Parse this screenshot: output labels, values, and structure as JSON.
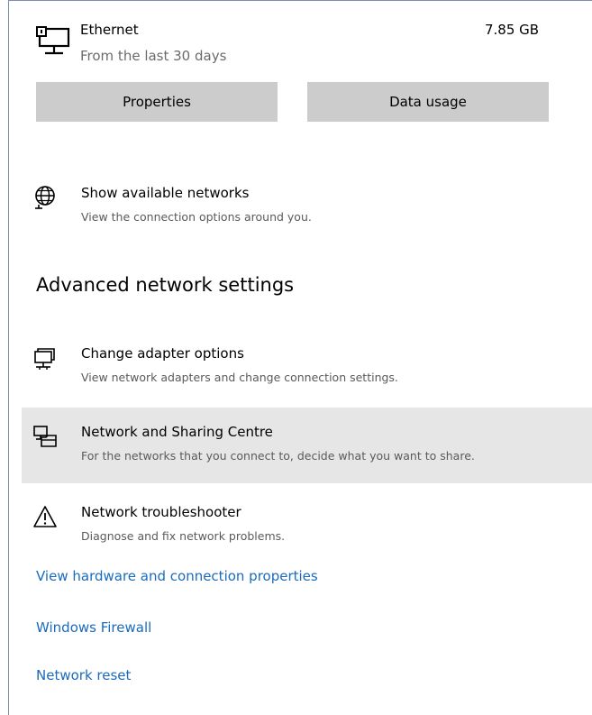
{
  "ethernet": {
    "name": "Ethernet",
    "period": "From the last 30 days",
    "usage": "7.85 GB",
    "icon": "ethernet-icon",
    "properties_label": "Properties",
    "data_usage_label": "Data usage"
  },
  "show_networks": {
    "title": "Show available networks",
    "description": "View the connection options around you.",
    "icon": "globe-icon"
  },
  "advanced": {
    "heading": "Advanced network settings",
    "items": [
      {
        "title": "Change adapter options",
        "description": "View network adapters and change connection settings.",
        "icon": "adapter-icon"
      },
      {
        "title": "Network and Sharing Centre",
        "description": "For the networks that you connect to, decide what you want to share.",
        "icon": "sharing-centre-icon"
      },
      {
        "title": "Network troubleshooter",
        "description": "Diagnose and fix network problems.",
        "icon": "warning-icon"
      }
    ]
  },
  "links": [
    "View hardware and connection properties",
    "Windows Firewall",
    "Network reset"
  ],
  "colors": {
    "link": "#1a6bbd",
    "button_bg": "#cccccc",
    "hover_bg": "#e6e6e6"
  }
}
